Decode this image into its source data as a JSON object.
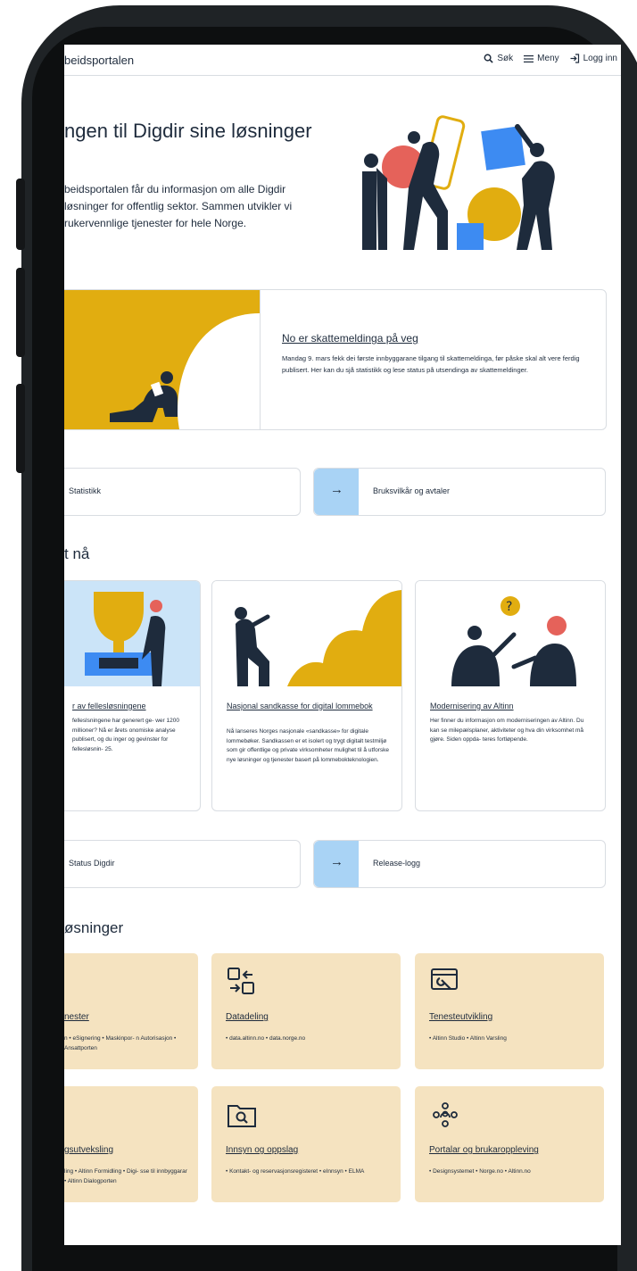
{
  "header": {
    "brand": "beidsportalen",
    "search_label": "Søk",
    "menu_label": "Meny",
    "login_label": "Logg inn"
  },
  "hero": {
    "title": "ngen til Digdir sine løsninger",
    "lead": "beidsportalen får du informasjon om alle Digdir løsninger for offentlig sektor. Sammen utvikler vi rukervennlige tjenester for hele Norge."
  },
  "featured_news": {
    "title": "No er skattemeldinga på veg",
    "text": "Mandag 9. mars fekk dei første innbyggarane tilgang til skattemeldinga, før påske skal alt vere ferdig publisert. Her kan du sjå statistikk og lese status på utsendinga av skattemeldinger."
  },
  "quick_links_1": [
    {
      "label": "Statistikk"
    },
    {
      "label": "Bruksvilkår og avtaler",
      "arrow": "→"
    }
  ],
  "news_section": {
    "heading": "t nå",
    "cards": [
      {
        "title": "r av fellesløsningene",
        "text": "felleslsningene har generert ge- wer 1200 millioner? Nå er årets onomiske analyse publisert, og du inger og gevinster for fellesløsnin- 25."
      },
      {
        "title": "Nasjonal sandkasse for digital lommebok",
        "text": "Nå lanseres Norges nasjonale «sandkasse» for digitale lommebøker. Sandkassen er et isolert og trygt digitalt testmiljø som gir offentlige og private virksomheter mulighet til å utforske nye løsninger og tjenester basert på lommebokteknologien."
      },
      {
        "title": "Modernisering av Altinn",
        "text": "Her finner du informasjon om moderniseringen av Altinn. Du kan se milepælsplaner, aktiviteter og hva din virksomhet må gjøre. Siden oppda- teres fortløpende."
      }
    ]
  },
  "quick_links_2": [
    {
      "label": "Status Digdir"
    },
    {
      "label": "Release-logg",
      "arrow": "→"
    }
  ],
  "solutions_section": {
    "heading": "øsninger",
    "cards": [
      {
        "title": "nester",
        "desc": "n • eSignering • Maskinpor- n Autorisasjon • Ansattporten",
        "icon": "services-icon"
      },
      {
        "title": "Datadeling",
        "desc": "• data.altinn.no • data.norge.no",
        "icon": "data-sharing-icon"
      },
      {
        "title": "Tenesteutvikling",
        "desc": "• Altinn Studio • Altinn Varsling",
        "icon": "service-development-icon"
      },
      {
        "title": "gsutveksling",
        "desc": "ling • Altinn Formidling • Digi- sse til innbyggarar • Altinn Dialogporten",
        "icon": "message-exchange-icon"
      },
      {
        "title": "Innsyn og oppslag",
        "desc": "• Kontakt- og reservasjonsregisteret • eInnsyn • ELMA",
        "icon": "search-document-icon"
      },
      {
        "title": "Portalar og brukaroppleving",
        "desc": "• Designsystemet • Norge.no • Altinn.no",
        "icon": "user-experience-icon"
      }
    ]
  },
  "colors": {
    "accent_yellow": "#e1ad10",
    "accent_blue": "#a9d3f5",
    "card_beige": "#f5e3c0",
    "figure_navy": "#1e2b3c",
    "coral": "#e5625a",
    "bright_blue": "#3d8bf2"
  }
}
